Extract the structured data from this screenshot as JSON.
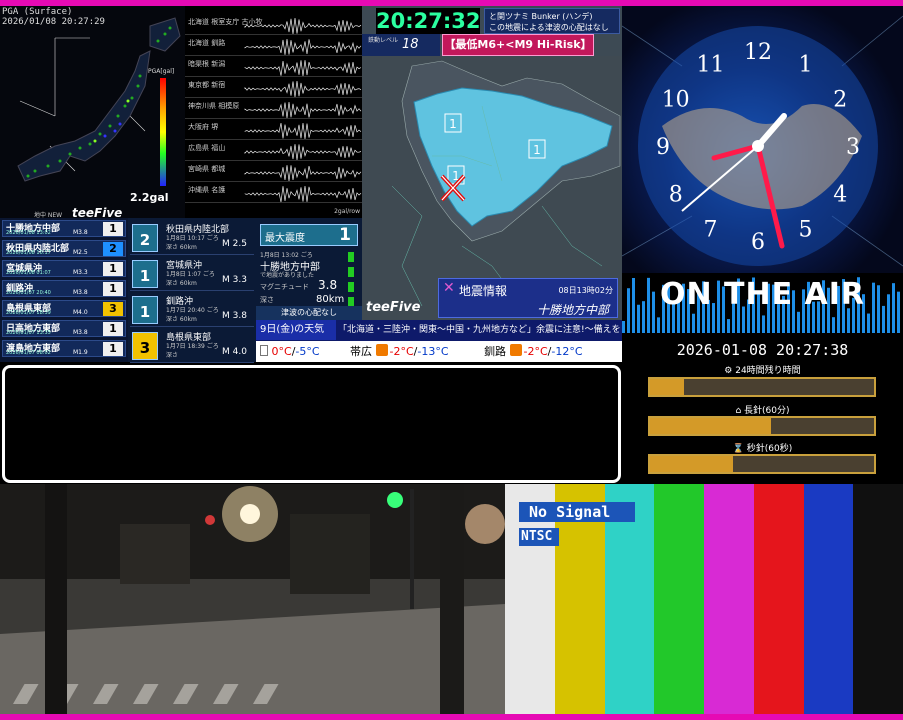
{
  "pga_panel": {
    "header_line1": "PGA (Surface)",
    "header_line2": "2026/01/08 20:27:29",
    "legend_title": "PGA[gal]",
    "gal_value": "2.2gal",
    "brand_small": "地中 NEW",
    "brand": "teeFive"
  },
  "seismograms": [
    {
      "label": "北海道 根室支庁 古小牧"
    },
    {
      "label": "北海道 釧路"
    },
    {
      "label": "暗渠根 新潟"
    },
    {
      "label": "東京都 新宿"
    },
    {
      "label": "神奈川県 相模原"
    },
    {
      "label": "大阪府 堺"
    },
    {
      "label": "広島県 福山"
    },
    {
      "label": "宮崎県 都城"
    },
    {
      "label": "沖縄県 名護"
    }
  ],
  "seismo_footer": "2gal/row",
  "intensity_list": [
    {
      "name": "十勝地方中部",
      "date": "2026/01/08 13:02",
      "mag": "M3.8",
      "int": "1"
    },
    {
      "name": "秋田県内陸北部",
      "date": "2026/01/08 10:17",
      "mag": "M2.5",
      "int": "2"
    },
    {
      "name": "宮城県沖",
      "date": "2026/01/08 01:07",
      "mag": "M3.3",
      "int": "1"
    },
    {
      "name": "釧路沖",
      "date": "2026/01/07 20:40",
      "mag": "M3.8",
      "int": "1"
    },
    {
      "name": "島根県東部",
      "date": "2026/01/07 18:39",
      "mag": "M4.0",
      "int": "3"
    },
    {
      "name": "日高地方東部",
      "date": "2026/01/07 13:35",
      "mag": "M3.8",
      "int": "1"
    },
    {
      "name": "渡島地方東部",
      "date": "2026/01/07 08:02",
      "mag": "M1.9",
      "int": "1"
    }
  ],
  "recent_quakes": [
    {
      "int": "2",
      "name": "秋田県内陸北部",
      "date": "1月8日 10:17 ごろ",
      "depth": "深さ 60km",
      "mag": "M 2.5"
    },
    {
      "int": "1",
      "name": "宮城県沖",
      "date": "1月8日 1:07 ごろ",
      "depth": "深さ 60km",
      "mag": "M 3.3"
    },
    {
      "int": "1",
      "name": "釧路沖",
      "date": "1月7日 20:40 ごろ",
      "depth": "深さ 60km",
      "mag": "M 3.8"
    },
    {
      "int": "3",
      "name": "島根県東部",
      "date": "1月7日 18:39 ごろ",
      "depth": "深さ",
      "mag": "M 4.0"
    }
  ],
  "latest": {
    "max_label": "最大震度",
    "max_value": "1",
    "date": "1月8日 13:02 ごろ",
    "region": "十勝地方中部",
    "note": "で地震がありました",
    "mag_label": "マグニチュード",
    "mag_value": "3.8",
    "depth_label": "深さ",
    "depth_value": "80km",
    "tsunami": "津波の心配なし"
  },
  "eew": {
    "clock": "20:27:32",
    "note_line1": "と関ツナミ Bunker (ハンデ)",
    "note_line2": "この地震による津波の心配はなし",
    "level_label": "鉄動レベル",
    "level_value": "18",
    "risk": "【最低M6+<M9 Hi-Risk】",
    "brand": "teeFive",
    "info_label": "地震情報",
    "info_time": "08日13時02分",
    "info_region": "十勝地方中部",
    "map_marks": [
      "1",
      "1",
      "1"
    ]
  },
  "weather": {
    "day": "9日(金)の天気",
    "warning": "「北海道・三陸沖・関東～中国・九州地方など」余震に注意!～備えを～",
    "cities": [
      {
        "name": "",
        "max": "0°C",
        "min": "-5°C"
      },
      {
        "name": "帯広",
        "max": "-2°C",
        "min": "-13°C"
      },
      {
        "name": "釧路",
        "max": "-2°C",
        "min": "-12°C"
      }
    ]
  },
  "clock_panel": {
    "numerals": [
      "12",
      "1",
      "2",
      "3",
      "4",
      "5",
      "6",
      "7",
      "8",
      "9",
      "10",
      "11"
    ]
  },
  "onair": {
    "title": "ON THE AIR",
    "datetime": "2026-01-08 20:27:38",
    "gauge_24h_label": "24時間残り時間",
    "gauge_24h_fill": 0.15,
    "gauge_min_label": "長針(60分)",
    "gauge_min_fill": 0.54,
    "gauge_sec_label": "秒針(60秒)",
    "gauge_sec_fill": 0.37
  },
  "test_pattern": {
    "no_signal": "No Signal",
    "ntsc": "NTSC",
    "colors": [
      "#e8e8e8",
      "#d6c200",
      "#2fd2c6",
      "#22c82a",
      "#d82ad4",
      "#e5151c",
      "#1a3ac2",
      "#101010"
    ]
  },
  "colors": {
    "accent_border": "#e60ab4",
    "clock_green": "#2bffa0",
    "risk_pink": "#c2185b",
    "intensity_1": "#f0f0f0",
    "intensity_2": "#1e90ff",
    "intensity_3": "#f2c200"
  }
}
